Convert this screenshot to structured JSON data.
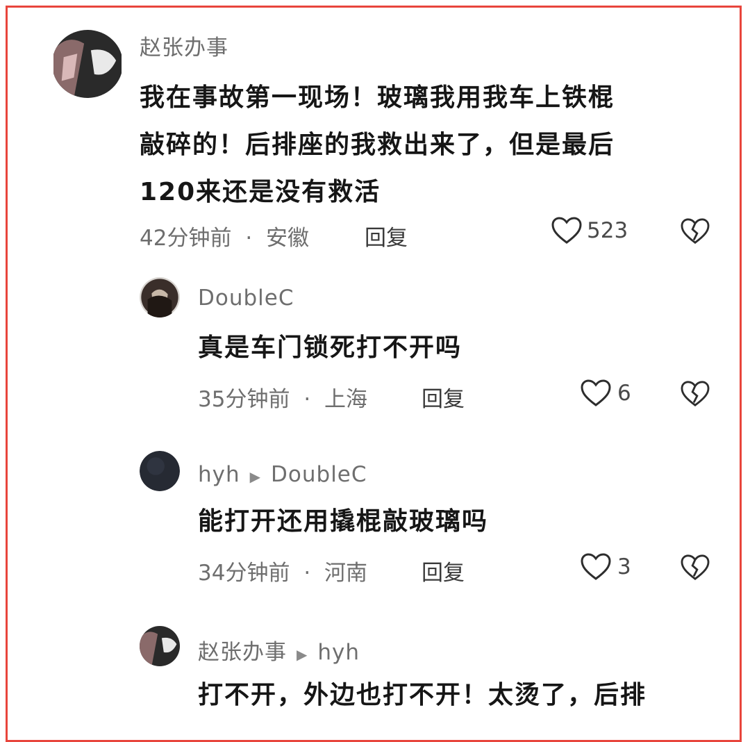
{
  "comments": [
    {
      "user": "赵张办事",
      "text_lines": [
        "我在事故第一现场！玻璃我用我车上铁棍",
        "敲碎的！后排座的我救出来了，但是最后",
        "120来还是没有救活"
      ],
      "time": "42分钟前",
      "location": "安徽",
      "reply_label": "回复",
      "likes": "523"
    },
    {
      "user": "DoubleC",
      "text_lines": [
        "真是车门锁死打不开吗"
      ],
      "time": "35分钟前",
      "location": "上海",
      "reply_label": "回复",
      "likes": "6"
    },
    {
      "user": "hyh",
      "reply_to": "DoubleC",
      "text_lines": [
        "能打开还用撬棍敲玻璃吗"
      ],
      "time": "34分钟前",
      "location": "河南",
      "reply_label": "回复",
      "likes": "3"
    },
    {
      "user": "赵张办事",
      "reply_to": "hyh",
      "text_lines": [
        "打不开，外边也打不开！太烫了，后排"
      ],
      "time": "",
      "location": "",
      "reply_label": "",
      "likes": ""
    }
  ],
  "meta_separator": "·",
  "reply_arrow": "▶",
  "icons": {
    "like": "heart-outline-icon",
    "dislike": "broken-heart-icon"
  },
  "colors": {
    "frame_border": "#e8453c",
    "username": "#6e6e6e",
    "text": "#161616"
  }
}
